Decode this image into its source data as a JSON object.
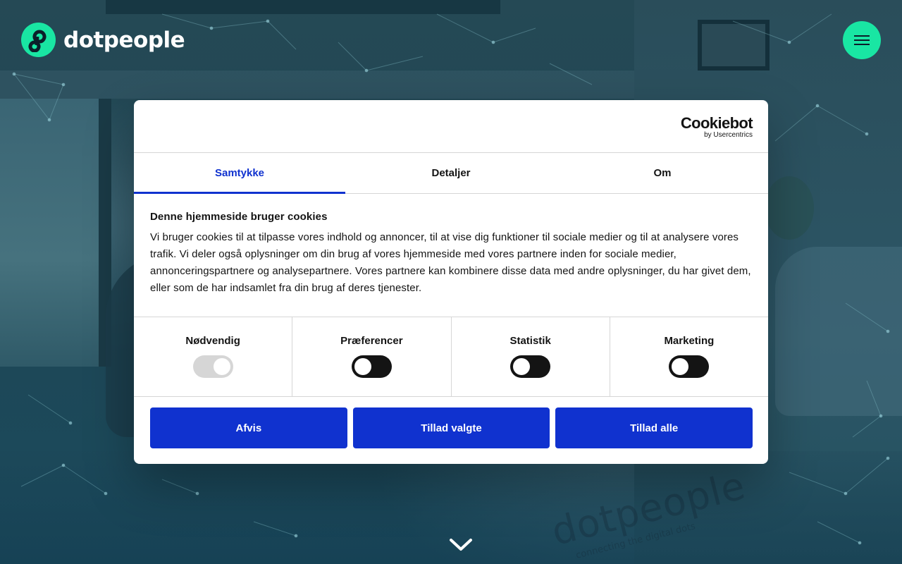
{
  "site": {
    "brand": "dotpeople",
    "accent_color": "#19e6a3",
    "watermark_brand": "dotpeople",
    "watermark_tagline": "connecting the digital dots"
  },
  "header": {
    "logo_icon": "dotpeople-logo-icon",
    "menu_icon": "hamburger-menu-icon"
  },
  "hero": {
    "scroll_icon": "chevron-down-icon"
  },
  "cookie_dialog": {
    "provider_name": "Cookiebot",
    "provider_byline": "by Usercentrics",
    "accent_color": "#1032cf",
    "tabs": [
      {
        "label": "Samtykke",
        "active": true
      },
      {
        "label": "Detaljer",
        "active": false
      },
      {
        "label": "Om",
        "active": false
      }
    ],
    "title": "Denne hjemmeside bruger cookies",
    "description": "Vi bruger cookies til at tilpasse vores indhold og annoncer, til at vise dig funktioner til sociale medier og til at analysere vores trafik. Vi deler også oplysninger om din brug af vores hjemmeside med vores partnere inden for sociale medier, annonceringspartnere og analysepartnere. Vores partnere kan kombinere disse data med andre oplysninger, du har givet dem, eller som de har indsamlet fra din brug af deres tjenester.",
    "categories": [
      {
        "label": "Nødvendig",
        "enabled": true,
        "locked": true
      },
      {
        "label": "Præferencer",
        "enabled": false,
        "locked": false
      },
      {
        "label": "Statistik",
        "enabled": false,
        "locked": false
      },
      {
        "label": "Marketing",
        "enabled": false,
        "locked": false
      }
    ],
    "buttons": {
      "reject": "Afvis",
      "allow_selected": "Tillad valgte",
      "allow_all": "Tillad alle"
    }
  }
}
